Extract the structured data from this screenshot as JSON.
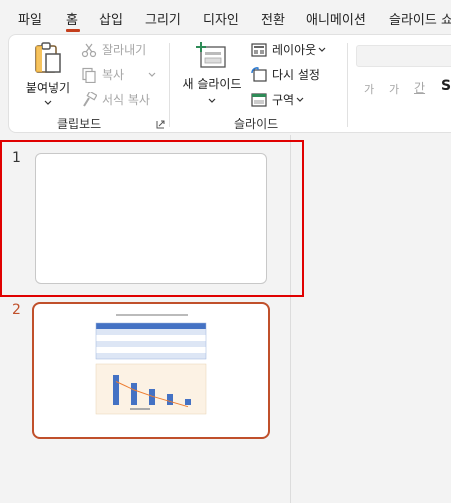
{
  "menu": {
    "tabs": [
      "파일",
      "홈",
      "삽입",
      "그리기",
      "디자인",
      "전환",
      "애니메이션",
      "슬라이드 쇼"
    ],
    "active": "홈"
  },
  "clipboard": {
    "paste_label": "붙여넣기",
    "cut_label": "잘라내기",
    "copy_label": "복사",
    "format_painter_label": "서식 복사",
    "group_label": "클립보드"
  },
  "slides_group": {
    "new_slide_label": "새 슬라이드",
    "layout_label": "레이아웃",
    "reset_label": "다시 설정",
    "section_label": "구역",
    "group_label": "슬라이드"
  },
  "font_group": {
    "grow_label": "가",
    "shrink_label": "가",
    "ganji_label": "간",
    "strike_label": "S"
  },
  "thumbnails": [
    {
      "number": "1"
    },
    {
      "number": "2"
    }
  ],
  "colors": {
    "accent": "#c43e1c",
    "selection": "#e00000",
    "active_slide_border": "#c0502b",
    "table_header": "#4472c4",
    "bar": "#4472c4",
    "line": "#ed7d31"
  }
}
